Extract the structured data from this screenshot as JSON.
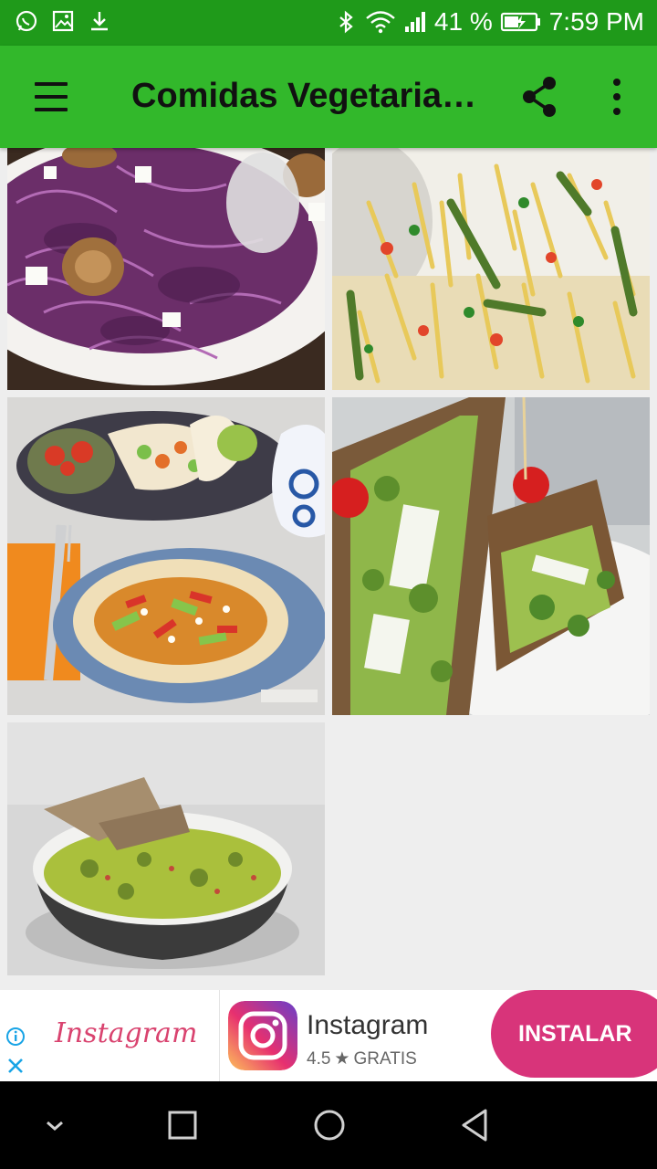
{
  "status_bar": {
    "battery_percent": "41 %",
    "time": "7:59 PM",
    "left_icons": [
      "whatsapp-icon",
      "gallery-icon",
      "download-icon"
    ],
    "right_icons": [
      "bluetooth-icon",
      "wifi-icon",
      "signal-icon",
      "battery-charging-icon"
    ]
  },
  "app_bar": {
    "title": "Comidas Vegetaria…",
    "background": "#32b82b",
    "status_color": "#1f9a1a",
    "icons": [
      "menu-icon",
      "share-icon",
      "more-vert-icon"
    ]
  },
  "recipes": [
    {
      "name": "red-cabbage-walnut-salad-image"
    },
    {
      "name": "pasta-with-vegetables-image"
    },
    {
      "name": "vegetable-tacos-image"
    },
    {
      "name": "avocado-sandwich-image"
    },
    {
      "name": "guacamole-bowl-image"
    }
  ],
  "ad": {
    "brand_logo_text": "Instagram",
    "app_name": "Instagram",
    "rating": "4.5",
    "price": "GRATIS",
    "install_label": "INSTALAR",
    "install_color": "#d8347a"
  },
  "nav_bar": {
    "icons": [
      "nav-collapse-icon",
      "recents-icon",
      "home-icon",
      "back-icon"
    ]
  }
}
